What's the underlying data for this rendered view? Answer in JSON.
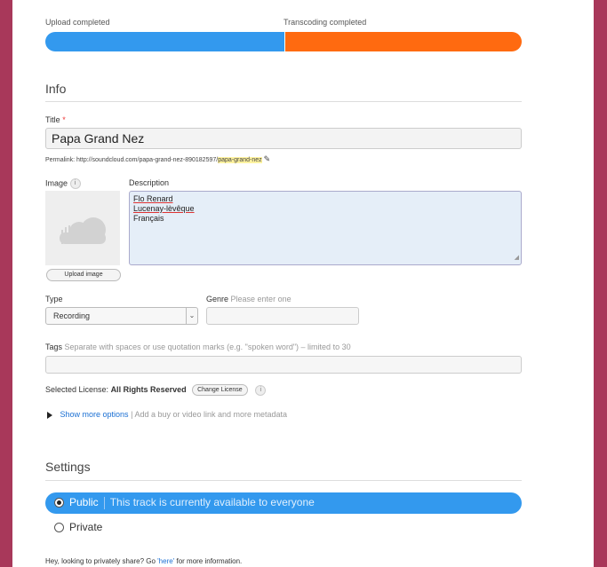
{
  "progress": {
    "upload_label": "Upload completed",
    "transcode_label": "Transcoding completed",
    "upload_color": "#3399ee",
    "transcode_color": "#ff6a10"
  },
  "info": {
    "heading": "Info",
    "title_label": "Title",
    "required_mark": "*",
    "title_value": "Papa Grand Nez",
    "permalink_prefix": "Permalink:",
    "permalink_base": "http://soundcloud.com/papa-grand-nez-890182597/",
    "permalink_slug": "papa-grand-nez",
    "image_label": "Image",
    "description_label": "Description",
    "description_lines": [
      "Flo Renard",
      "Lucenay-lèvêque",
      "Français"
    ],
    "upload_image_label": "Upload image",
    "type_label": "Type",
    "type_value": "Recording",
    "genre_label": "Genre",
    "genre_hint": "Please enter one",
    "tags_label": "Tags",
    "tags_hint": "Separate with spaces or use quotation marks (e.g. \"spoken word\") – limited to 30",
    "license_prefix": "Selected License:",
    "license_value": "All Rights Reserved",
    "change_license_label": "Change License",
    "more_options_link": "Show more options",
    "more_options_hint": "Add a buy or video link and more metadata"
  },
  "settings": {
    "heading": "Settings",
    "public_label": "Public",
    "public_desc": "This track is currently available to everyone",
    "private_label": "Private",
    "footer_prefix": "Hey, looking to privately share? Go",
    "footer_link": "'here'",
    "footer_suffix": "for more information."
  },
  "icons": {
    "info": "info-icon",
    "pencil": "pencil-icon",
    "cloud": "cloud-placeholder-icon",
    "dropdown": "chevron-down-icon"
  }
}
